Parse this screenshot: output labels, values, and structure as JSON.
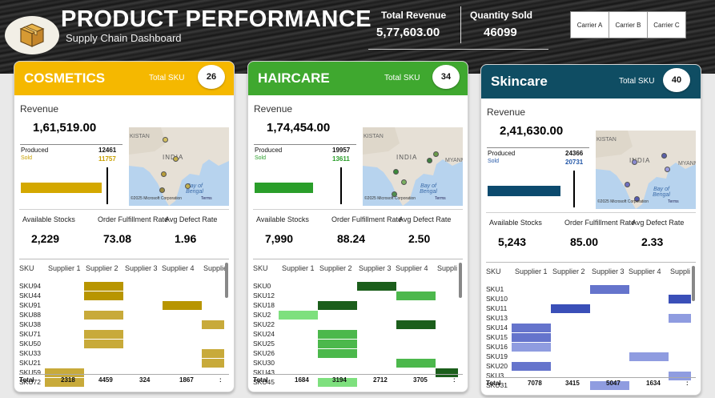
{
  "header": {
    "title": "PRODUCT PERFORMANCE",
    "subtitle": "Supply Chain Dashboard",
    "total_revenue_label": "Total Revenue",
    "total_revenue_value": "5,77,603.00",
    "quantity_sold_label": "Quantity Sold",
    "quantity_sold_value": "46099",
    "carriers": [
      "Carrier A",
      "Carrier B",
      "Carrier C"
    ]
  },
  "cards": [
    {
      "name": "COSMETICS",
      "sku_label": "Total SKU",
      "sku_count": "26",
      "head_color": "#f5b800",
      "bar_color": "#d4a800",
      "revenue_label": "Revenue",
      "revenue_value": "1,61,519.00",
      "produced_label": "Produced",
      "produced_value": "12461",
      "sold_label": "Sold",
      "sold_value": "11757",
      "sold_color": "#c9a100",
      "map_credit": "©2025 Microsoft Corporation",
      "map_terms": "Terms",
      "map_labels": [
        "KISTAN",
        "INDIA",
        "Bay of Bengal"
      ],
      "stats": [
        {
          "label": "Available Stocks",
          "value": "2,229"
        },
        {
          "label": "Order Fulfillment Rate",
          "value": "73.08"
        },
        {
          "label": "Avg Defect Rate",
          "value": "1.96"
        }
      ],
      "grid": {
        "headers": [
          "SKU",
          "Supplier 1",
          "Supplier 2",
          "Supplier 3",
          "Supplier 4",
          "Supplie"
        ],
        "rows": [
          "SKU94",
          "SKU44",
          "SKU91",
          "SKU88",
          "SKU38",
          "SKU71",
          "SKU50",
          "SKU33",
          "SKU21",
          "SKU59",
          "SKU72"
        ],
        "total_label": "Total",
        "totals": [
          "2318",
          "4459",
          "324",
          "1867",
          ":"
        ]
      }
    },
    {
      "name": "HAIRCARE",
      "sku_label": "Total SKU",
      "sku_count": "34",
      "head_color": "#3fa82f",
      "bar_color": "#2a9e2a",
      "revenue_label": "Revenue",
      "revenue_value": "1,74,454.00",
      "produced_label": "Produced",
      "produced_value": "19957",
      "sold_label": "Sold",
      "sold_value": "13611",
      "sold_color": "#2a9e2a",
      "map_credit": "©2025 Microsoft Corporation",
      "map_terms": "Terms",
      "map_labels": [
        "KISTAN",
        "INDIA",
        "Bay of Bengal",
        "MYANM"
      ],
      "stats": [
        {
          "label": "Available Stocks",
          "value": "7,990"
        },
        {
          "label": "Order Fulfillment Rate",
          "value": "88.24"
        },
        {
          "label": "Avg Defect Rate",
          "value": "2.50"
        }
      ],
      "grid": {
        "headers": [
          "SKU",
          "Supplier 1",
          "Supplier 2",
          "Supplier 3",
          "Supplier 4",
          "Suppli"
        ],
        "rows": [
          "SKU0",
          "SKU12",
          "SKU18",
          "SKU2",
          "SKU22",
          "SKU24",
          "SKU25",
          "SKU26",
          "SKU30",
          "SKU43",
          "SKU45"
        ],
        "total_label": "Total",
        "totals": [
          "1684",
          "3194",
          "2712",
          "3705",
          ":"
        ]
      }
    },
    {
      "name": "Skincare",
      "sku_label": "Total SKU",
      "sku_count": "40",
      "head_color": "#0f4d63",
      "bar_color": "#0c4a6e",
      "revenue_label": "Revenue",
      "revenue_value": "2,41,630.00",
      "produced_label": "Produced",
      "produced_value": "24366",
      "sold_label": "Sold",
      "sold_value": "20731",
      "sold_color": "#2458a8",
      "map_credit": "©2025 Microsoft Corporation",
      "map_terms": "Terms",
      "map_labels": [
        "KISTAN",
        "INDIA",
        "Bay of Bengal",
        "MYANM"
      ],
      "stats": [
        {
          "label": "Available Stocks",
          "value": "5,243"
        },
        {
          "label": "Order Fulfillment Rate",
          "value": "85.00"
        },
        {
          "label": "Avg Defect Rate",
          "value": "2.33"
        }
      ],
      "grid": {
        "headers": [
          "SKU",
          "Supplier 1",
          "Supplier 2",
          "Supplier 3",
          "Supplier 4",
          "Suppli"
        ],
        "rows": [
          "SKU1",
          "SKU10",
          "SKU11",
          "SKU13",
          "SKU14",
          "SKU15",
          "SKU16",
          "SKU19",
          "SKU20",
          "SKU3",
          "SKU31"
        ],
        "total_label": "Total",
        "totals": [
          "7078",
          "3415",
          "5047",
          "1634",
          ":"
        ]
      }
    }
  ]
}
